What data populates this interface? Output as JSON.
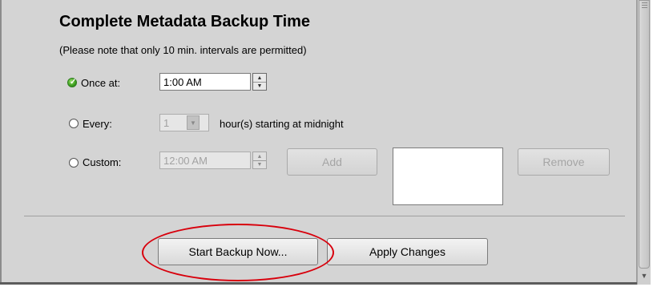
{
  "section": {
    "title": "Complete Metadata Backup Time",
    "note": "(Please note that only 10 min. intervals are permitted)"
  },
  "schedule": {
    "once": {
      "label": "Once at:",
      "selected": true,
      "time_value": "1:00 AM"
    },
    "every": {
      "label": "Every:",
      "selected": false,
      "hours_value": "1",
      "suffix": "hour(s) starting at midnight"
    },
    "custom": {
      "label": "Custom:",
      "selected": false,
      "time_value": "12:00 AM",
      "add_label": "Add",
      "remove_label": "Remove"
    }
  },
  "icons": {
    "radio_selected": "check-circle-icon",
    "radio_unselected": "radio-empty-icon",
    "spin_up": "▲",
    "spin_down": "▼",
    "combo_arrow": "▼",
    "scroll_down": "▼"
  },
  "actions": {
    "start_backup_label": "Start Backup Now...",
    "apply_changes_label": "Apply Changes"
  },
  "colors": {
    "panel_bg": "#d4d4d4",
    "annotation": "#d8000c",
    "selected_radio": "#3c9f1f"
  }
}
